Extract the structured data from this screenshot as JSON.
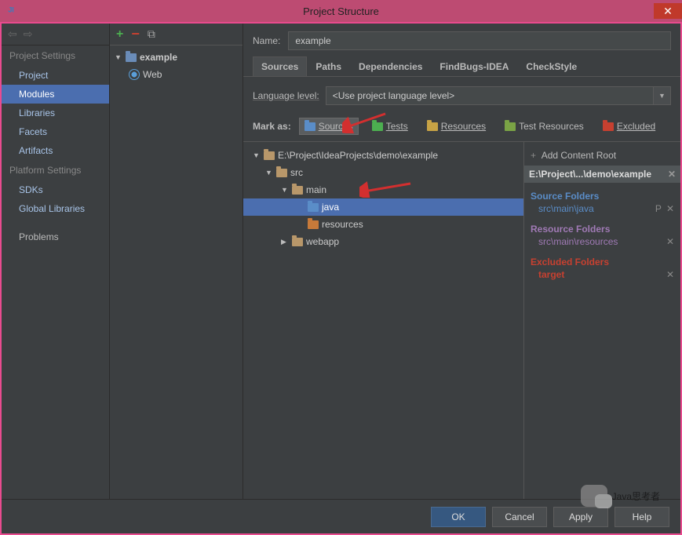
{
  "titlebar": {
    "title": "Project Structure"
  },
  "sidebar": {
    "section1": "Project Settings",
    "items1": [
      "Project",
      "Modules",
      "Libraries",
      "Facets",
      "Artifacts"
    ],
    "section2": "Platform Settings",
    "items2": [
      "SDKs",
      "Global Libraries"
    ],
    "problems": "Problems"
  },
  "moduleTree": {
    "root": "example",
    "child": "Web"
  },
  "name": {
    "label": "Name:",
    "value": "example"
  },
  "tabs": [
    "Sources",
    "Paths",
    "Dependencies",
    "FindBugs-IDEA",
    "CheckStyle"
  ],
  "lang": {
    "label": "Language level:",
    "value": "<Use project language level>"
  },
  "mark": {
    "label": "Mark as:",
    "sources": "Sources",
    "tests": "Tests",
    "resources": "Resources",
    "testResources": "Test Resources",
    "excluded": "Excluded"
  },
  "fileTree": {
    "root": "E:\\Project\\IdeaProjects\\demo\\example",
    "src": "src",
    "main": "main",
    "java": "java",
    "resources": "resources",
    "webapp": "webapp"
  },
  "rightPanel": {
    "addRoot": "Add Content Root",
    "rootPath": "E:\\Project\\...\\demo\\example",
    "srcTitle": "Source Folders",
    "srcPath": "src\\main\\java",
    "resTitle": "Resource Folders",
    "resPath": "src\\main\\resources",
    "exclTitle": "Excluded Folders",
    "exclPath": "target"
  },
  "buttons": {
    "ok": "OK",
    "cancel": "Cancel",
    "apply": "Apply",
    "help": "Help"
  },
  "watermark": "Java思考者"
}
